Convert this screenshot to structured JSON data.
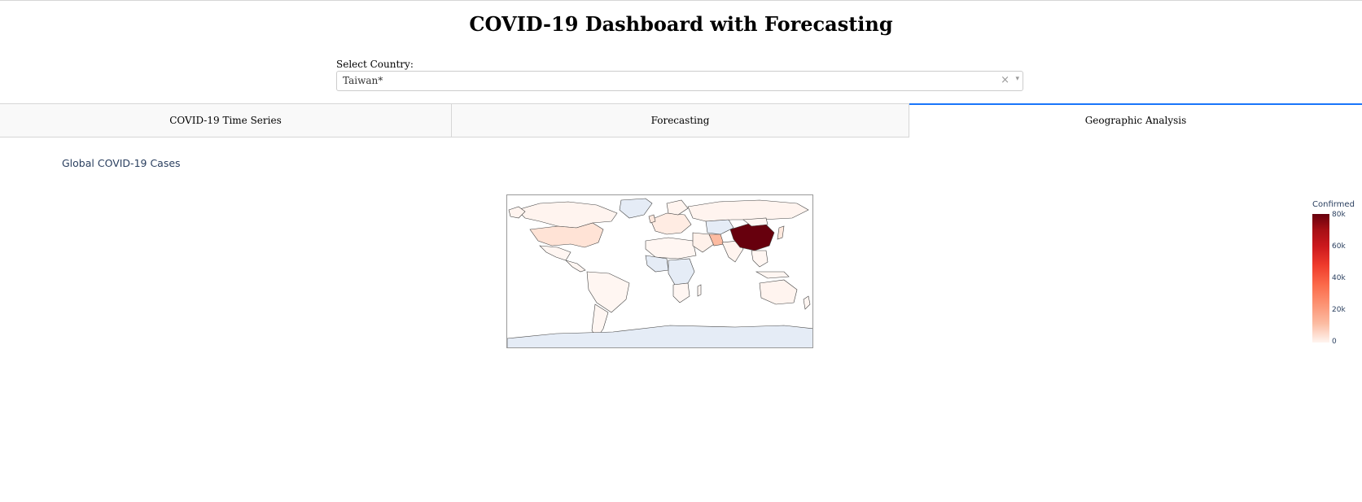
{
  "header": {
    "title": "COVID-19 Dashboard with Forecasting"
  },
  "country_select": {
    "label": "Select Country:",
    "value": "Taiwan*",
    "clear_icon": "×",
    "caret_icon": "▾"
  },
  "tabs": [
    {
      "label": "COVID-19 Time Series",
      "active": false
    },
    {
      "label": "Forecasting",
      "active": false
    },
    {
      "label": "Geographic Analysis",
      "active": true
    }
  ],
  "map": {
    "title": "Global COVID-19 Cases",
    "colorbar": {
      "title": "Confirmed",
      "ticks": [
        "80k",
        "60k",
        "40k",
        "20k",
        "0"
      ]
    },
    "colors": {
      "no_data": "#e5ecf6",
      "land_low": "#fff5f0",
      "china": "#67000d",
      "accent": "#1975fa"
    }
  }
}
